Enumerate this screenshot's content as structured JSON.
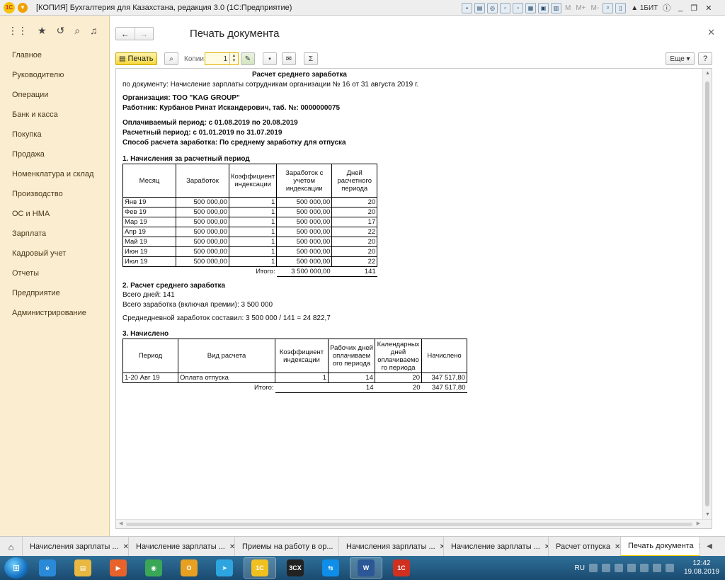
{
  "window": {
    "title": "[КОПИЯ] Бухгалтерия для Казахстана, редакция 3.0  (1С:Предприятие)",
    "logo": "1С",
    "toolbar_text": [
      "M",
      "M+",
      "M-"
    ],
    "user": "1БИТ"
  },
  "sidebar": {
    "items": [
      {
        "label": "Главное"
      },
      {
        "label": "Руководителю"
      },
      {
        "label": "Операции"
      },
      {
        "label": "Банк и касса"
      },
      {
        "label": "Покупка"
      },
      {
        "label": "Продажа"
      },
      {
        "label": "Номенклатура и склад"
      },
      {
        "label": "Производство"
      },
      {
        "label": "ОС и НМА"
      },
      {
        "label": "Зарплата"
      },
      {
        "label": "Кадровый учет"
      },
      {
        "label": "Отчеты"
      },
      {
        "label": "Предприятие"
      },
      {
        "label": "Администрирование"
      }
    ]
  },
  "form": {
    "title": "Печать документа",
    "print_label": "Печать",
    "copies_label": "Копии:",
    "copies_value": "1",
    "more_label": "Еще",
    "help_label": "?"
  },
  "document": {
    "title": "Расчет среднего заработка",
    "basis": "по документу: Начисление зарплаты сотрудникам организации № 16 от 31 августа 2019 г.",
    "organization": "Организация: ТОО \"KAG GROUP\"",
    "employee": "Работник: Курбанов Ринат Искандерович, таб. №: 0000000075",
    "paid_period": "Оплачиваемый период: с 01.08.2019 по 20.08.2019",
    "calc_period": "Расчетный период: с 01.01.2019 по 31.07.2019",
    "method": "Способ расчета заработка: По среднему заработку для отпуска",
    "section1": {
      "heading": "1. Начисления за расчетный период",
      "headers": [
        "Месяц",
        "Заработок",
        "Коэффициент индексации",
        "Заработок с учетом индексации",
        "Дней расчетного периода"
      ],
      "rows": [
        [
          "Янв 19",
          "500 000,00",
          "1",
          "500 000,00",
          "20"
        ],
        [
          "Фев 19",
          "500 000,00",
          "1",
          "500 000,00",
          "20"
        ],
        [
          "Мар 19",
          "500 000,00",
          "1",
          "500 000,00",
          "17"
        ],
        [
          "Апр 19",
          "500 000,00",
          "1",
          "500 000,00",
          "22"
        ],
        [
          "Май 19",
          "500 000,00",
          "1",
          "500 000,00",
          "20"
        ],
        [
          "Июн 19",
          "500 000,00",
          "1",
          "500 000,00",
          "20"
        ],
        [
          "Июл 19",
          "500 000,00",
          "1",
          "500 000,00",
          "22"
        ]
      ],
      "total_label": "Итого:",
      "total_amount": "3 500 000,00",
      "total_days": "141"
    },
    "section2": {
      "heading": "2. Расчет среднего  заработка",
      "days": "Всего дней: 141",
      "earnings": "Всего заработка (включая премии): 3 500 000",
      "daily": "Среднедневной заработок составил: 3 500 000 / 141 = 24 822,7"
    },
    "section3": {
      "heading": "3. Начислено",
      "headers": [
        "Период",
        "Вид расчета",
        "Коэффициент индексации",
        "Рабочих дней оплачиваем ого периода",
        "Календарных дней оплачиваемо го периода",
        "Начислено"
      ],
      "rows": [
        [
          "1-20 Авг 19",
          "Оплата отпуска",
          "1",
          "14",
          "20",
          "347 517,80"
        ]
      ],
      "total_label": "Итого:",
      "total_work": "14",
      "total_cal": "20",
      "total_amount": "347 517,80"
    }
  },
  "tabs": [
    {
      "label": "Начисления зарплаты ..."
    },
    {
      "label": "Начисление зарплаты ..."
    },
    {
      "label": "Приемы на работу в ор..."
    },
    {
      "label": "Начисления зарплаты ..."
    },
    {
      "label": "Начисление зарплаты ..."
    },
    {
      "label": "Расчет отпуска"
    },
    {
      "label": "Печать документа"
    }
  ],
  "taskbar": {
    "language": "RU",
    "time": "12:42",
    "date": "19.08.2019",
    "apps": [
      {
        "icon": "ie-icon",
        "glyph": "e",
        "color": "#2a8ad8"
      },
      {
        "icon": "folder-icon",
        "glyph": "▤",
        "color": "#e8b840"
      },
      {
        "icon": "media-player-icon",
        "glyph": "▶",
        "color": "#e8622c"
      },
      {
        "icon": "chrome-icon",
        "glyph": "◉",
        "color": "#3aa757"
      },
      {
        "icon": "outlook-icon",
        "glyph": "O",
        "color": "#e8a020"
      },
      {
        "icon": "telegram-icon",
        "glyph": "➤",
        "color": "#2ca5e0"
      },
      {
        "icon": "1c-icon",
        "glyph": "1С",
        "color": "#f0c020"
      },
      {
        "icon": "3cx-icon",
        "glyph": "3CX",
        "color": "#222222"
      },
      {
        "icon": "teamviewer-icon",
        "glyph": "⇆",
        "color": "#0e8ee9"
      },
      {
        "icon": "word-icon",
        "glyph": "W",
        "color": "#2b5797"
      },
      {
        "icon": "1c-alt-icon",
        "glyph": "1С",
        "color": "#d03020"
      }
    ]
  }
}
